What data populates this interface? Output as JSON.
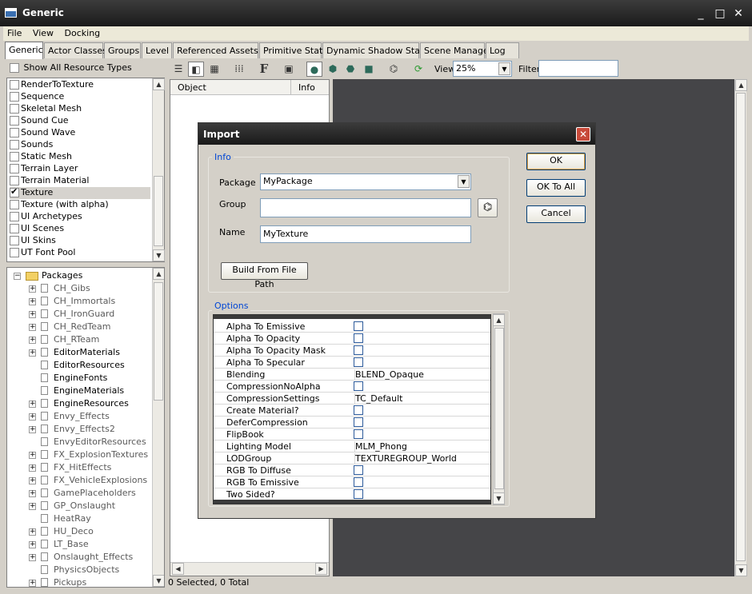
{
  "window": {
    "title": "Generic",
    "minimize_icon": "_",
    "maximize_icon": "□",
    "close_icon": "✕"
  },
  "menu": [
    "File",
    "View",
    "Docking"
  ],
  "tabs": [
    "Generic",
    "Actor Classes",
    "Groups",
    "Level",
    "Referenced Assets",
    "Primitive Stats",
    "Dynamic Shadow Stats",
    "Scene Manager",
    "Log"
  ],
  "active_tab": "Generic",
  "resource_types": {
    "show_all_label": "Show All Resource Types",
    "show_all_checked": false,
    "items": [
      {
        "label": "RenderToTexture",
        "checked": false
      },
      {
        "label": "Sequence",
        "checked": false
      },
      {
        "label": "Skeletal Mesh",
        "checked": false
      },
      {
        "label": "Sound Cue",
        "checked": false
      },
      {
        "label": "Sound Wave",
        "checked": false
      },
      {
        "label": "Sounds",
        "checked": false
      },
      {
        "label": "Static Mesh",
        "checked": false
      },
      {
        "label": "Terrain Layer",
        "checked": false
      },
      {
        "label": "Terrain Material",
        "checked": false
      },
      {
        "label": "Texture",
        "checked": true
      },
      {
        "label": "Texture (with alpha)",
        "checked": false
      },
      {
        "label": "UI Archetypes",
        "checked": false
      },
      {
        "label": "UI Scenes",
        "checked": false
      },
      {
        "label": "UI Skins",
        "checked": false
      },
      {
        "label": "UT Font Pool",
        "checked": false
      }
    ]
  },
  "packages": {
    "root_label": "Packages",
    "items": [
      {
        "label": "CH_Gibs",
        "expandable": true,
        "loaded": false
      },
      {
        "label": "CH_Immortals",
        "expandable": true,
        "loaded": false
      },
      {
        "label": "CH_IronGuard",
        "expandable": true,
        "loaded": false
      },
      {
        "label": "CH_RedTeam",
        "expandable": true,
        "loaded": false
      },
      {
        "label": "CH_RTeam",
        "expandable": true,
        "loaded": false
      },
      {
        "label": "EditorMaterials",
        "expandable": true,
        "loaded": true
      },
      {
        "label": "EditorResources",
        "expandable": false,
        "loaded": true
      },
      {
        "label": "EngineFonts",
        "expandable": false,
        "loaded": true
      },
      {
        "label": "EngineMaterials",
        "expandable": false,
        "loaded": true
      },
      {
        "label": "EngineResources",
        "expandable": true,
        "loaded": true
      },
      {
        "label": "Envy_Effects",
        "expandable": true,
        "loaded": false
      },
      {
        "label": "Envy_Effects2",
        "expandable": true,
        "loaded": false
      },
      {
        "label": "EnvyEditorResources",
        "expandable": false,
        "loaded": false
      },
      {
        "label": "FX_ExplosionTextures",
        "expandable": true,
        "loaded": false
      },
      {
        "label": "FX_HitEffects",
        "expandable": true,
        "loaded": false
      },
      {
        "label": "FX_VehicleExplosions",
        "expandable": true,
        "loaded": false
      },
      {
        "label": "GamePlaceholders",
        "expandable": true,
        "loaded": false
      },
      {
        "label": "GP_Onslaught",
        "expandable": true,
        "loaded": false
      },
      {
        "label": "HeatRay",
        "expandable": false,
        "loaded": false
      },
      {
        "label": "HU_Deco",
        "expandable": true,
        "loaded": false
      },
      {
        "label": "LT_Base",
        "expandable": true,
        "loaded": false
      },
      {
        "label": "Onslaught_Effects",
        "expandable": true,
        "loaded": false
      },
      {
        "label": "PhysicsObjects",
        "expandable": false,
        "loaded": false
      },
      {
        "label": "Pickups",
        "expandable": true,
        "loaded": false
      }
    ]
  },
  "toolbar": {
    "buttons": [
      "list-view-icon",
      "split-view-icon",
      "thumbnail-view-icon",
      "grid-icon",
      "font-icon",
      "image-icon",
      "sphere-icon",
      "cube-icon",
      "cylinder-icon",
      "plane-icon",
      "binoculars-icon",
      "sync-icon"
    ],
    "view_label": "View",
    "view_value": "25%",
    "filter_label": "Filter",
    "filter_value": ""
  },
  "object_list": {
    "col_object": "Object",
    "col_info": "Info"
  },
  "status": "0 Selected, 0 Total",
  "dialog": {
    "title": "Import",
    "info_label": "Info",
    "package_label": "Package",
    "package_value": "MyPackage",
    "group_label": "Group",
    "group_value": "",
    "name_label": "Name",
    "name_value": "MyTexture",
    "build_button": "Build From File Path",
    "ok_button": "OK",
    "ok_all_button": "OK To All",
    "cancel_button": "Cancel",
    "options_label": "Options",
    "options": [
      {
        "name": "Alpha To Emissive",
        "type": "bool",
        "value": false
      },
      {
        "name": "Alpha To Opacity",
        "type": "bool",
        "value": false
      },
      {
        "name": "Alpha To Opacity Mask",
        "type": "bool",
        "value": false
      },
      {
        "name": "Alpha To Specular",
        "type": "bool",
        "value": false
      },
      {
        "name": "Blending",
        "type": "text",
        "value": "BLEND_Opaque"
      },
      {
        "name": "CompressionNoAlpha",
        "type": "bool",
        "value": false
      },
      {
        "name": "CompressionSettings",
        "type": "text",
        "value": "TC_Default"
      },
      {
        "name": "Create Material?",
        "type": "bool",
        "value": false
      },
      {
        "name": "DeferCompression",
        "type": "bool",
        "value": false
      },
      {
        "name": "FlipBook",
        "type": "bool",
        "value": false
      },
      {
        "name": "Lighting Model",
        "type": "text",
        "value": "MLM_Phong"
      },
      {
        "name": "LODGroup",
        "type": "text",
        "value": "TEXTUREGROUP_World"
      },
      {
        "name": "RGB To Diffuse",
        "type": "bool",
        "value": false
      },
      {
        "name": "RGB To Emissive",
        "type": "bool",
        "value": false
      },
      {
        "name": "Two Sided?",
        "type": "bool",
        "value": false
      }
    ]
  }
}
